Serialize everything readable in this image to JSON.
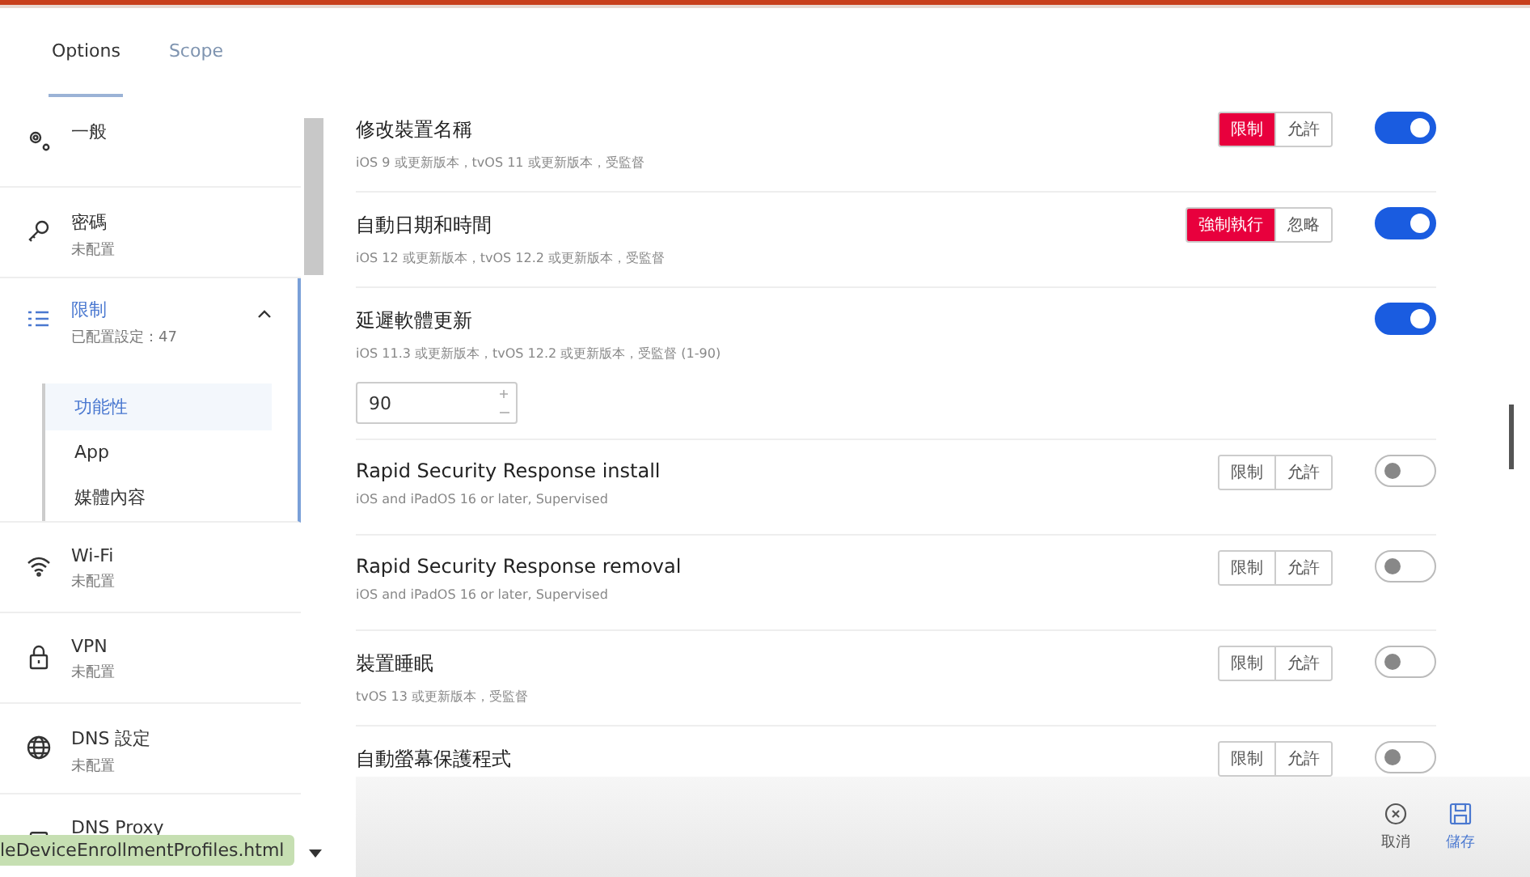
{
  "tabs": [
    {
      "label": "Options",
      "selected": true
    },
    {
      "label": "Scope",
      "selected": false
    }
  ],
  "sidebar": {
    "items": [
      {
        "title": "一般",
        "selected": false
      },
      {
        "title": "密碼",
        "subtitle": "未配置",
        "selected": false
      },
      {
        "title": "限制",
        "subtitle": "已配置設定：47",
        "selected": true,
        "expanded": true,
        "children": [
          {
            "label": "功能性",
            "selected": true
          },
          {
            "label": "App",
            "selected": false
          },
          {
            "label": "媒體內容",
            "selected": false
          }
        ]
      },
      {
        "title": "Wi-Fi",
        "subtitle": "未配置",
        "selected": false
      },
      {
        "title": "VPN",
        "subtitle": "未配置",
        "selected": false
      },
      {
        "title": "DNS 設定",
        "subtitle": "未配置",
        "selected": false
      },
      {
        "title": "DNS Proxy",
        "selected": false
      }
    ]
  },
  "settings": [
    {
      "title": "修改裝置名稱",
      "subtitle": "iOS 9 或更新版本，tvOS 11 或更新版本，受監督",
      "options": [
        {
          "label": "限制",
          "selected": true
        },
        {
          "label": "允許",
          "selected": false
        }
      ],
      "on": true
    },
    {
      "title": "自動日期和時間",
      "subtitle": "iOS 12 或更新版本，tvOS 12.2 或更新版本，受監督",
      "options": [
        {
          "label": "強制執行",
          "selected": true
        },
        {
          "label": "忽略",
          "selected": false
        }
      ],
      "on": true
    },
    {
      "title": "延遲軟體更新",
      "subtitle": "iOS 11.3 或更新版本，tvOS 12.2 或更新版本，受監督 (1-90)",
      "value": "90",
      "on": true
    },
    {
      "title": "Rapid Security Response install",
      "subtitle": "iOS and iPadOS 16 or later, Supervised",
      "options": [
        {
          "label": "限制",
          "selected": false
        },
        {
          "label": "允許",
          "selected": false
        }
      ],
      "on": false
    },
    {
      "title": "Rapid Security Response removal",
      "subtitle": "iOS and iPadOS 16 or later, Supervised",
      "options": [
        {
          "label": "限制",
          "selected": false
        },
        {
          "label": "允許",
          "selected": false
        }
      ],
      "on": false
    },
    {
      "title": "裝置睡眠",
      "subtitle": "tvOS 13 或更新版本，受監督",
      "options": [
        {
          "label": "限制",
          "selected": false
        },
        {
          "label": "允許",
          "selected": false
        }
      ],
      "on": false
    },
    {
      "title": "自動螢幕保護程式",
      "options": [
        {
          "label": "限制",
          "selected": false
        },
        {
          "label": "允許",
          "selected": false
        }
      ],
      "on": false
    }
  ],
  "footer": {
    "buttons": [
      {
        "label": "取消",
        "kind": "cancel"
      },
      {
        "label": "儲存",
        "kind": "save"
      }
    ]
  },
  "status_bar": {
    "url": "leDeviceEnrollmentProfiles.html"
  }
}
